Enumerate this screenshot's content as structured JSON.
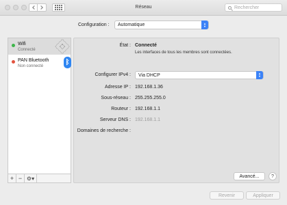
{
  "window": {
    "title": "Réseau"
  },
  "search": {
    "placeholder": "Rechercher"
  },
  "configuration": {
    "label": "Configuration :",
    "value": "Automatique"
  },
  "sidebar": {
    "services": [
      {
        "name": "Wifi",
        "status": "Connecté",
        "status_color": "#3db64a"
      },
      {
        "name": "PAN Bluetooth",
        "status": "Non connecté",
        "status_color": "#e2533f"
      }
    ],
    "bluetooth_glyph": "ᛒ",
    "add_label": "+",
    "remove_label": "−",
    "gear_label": "⚙▾"
  },
  "details": {
    "state_label": "État :",
    "state_value": "Connecté",
    "state_note": "Les interfaces de tous les membres sont connectées.",
    "ipv4_label": "Configurer IPv4 :",
    "ipv4_value": "Via DHCP",
    "ip_label": "Adresse IP :",
    "ip_value": "192.168.1.36",
    "subnet_label": "Sous-réseau :",
    "subnet_value": "255.255.255.0",
    "router_label": "Routeur :",
    "router_value": "192.168.1.1",
    "dns_label": "Serveur DNS :",
    "dns_value": "192.168.1.1",
    "search_domains_label": "Domaines de recherche :"
  },
  "buttons": {
    "advanced": "Avancé...",
    "help": "?",
    "revert": "Revenir",
    "apply": "Appliquer"
  },
  "colors": {
    "accent": "#3b82f7",
    "bluetooth": "#2f86f2"
  }
}
